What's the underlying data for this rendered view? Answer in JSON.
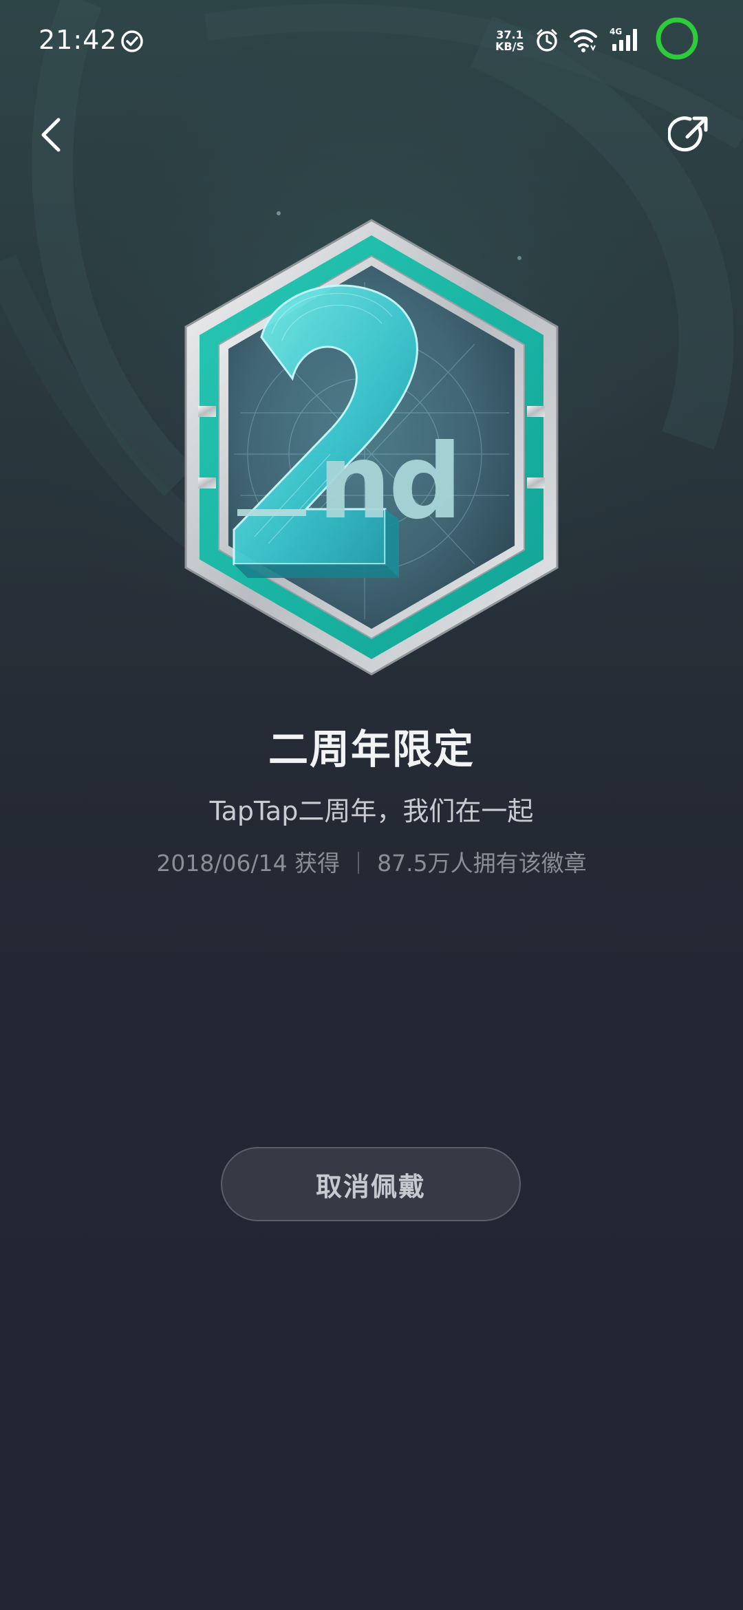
{
  "status_bar": {
    "time": "21:42",
    "net_speed_value": "37.1",
    "net_speed_unit": "KB/S",
    "network_type": "4G",
    "battery_color": "#2ecc3a"
  },
  "nav": {
    "back_icon": "chevron-left-icon",
    "share_icon": "share-icon"
  },
  "badge": {
    "title": "二周年限定",
    "subtitle": "TapTap二周年，我们在一起",
    "obtained_date": "2018/06/14 获得",
    "owners": "87.5万人拥有该徽章",
    "colors": {
      "frame_teal": "#1fb8a8",
      "frame_silver": "#d9dcdf",
      "inner_bg": "#3c5f6e"
    }
  },
  "actions": {
    "unwear_label": "取消佩戴"
  }
}
